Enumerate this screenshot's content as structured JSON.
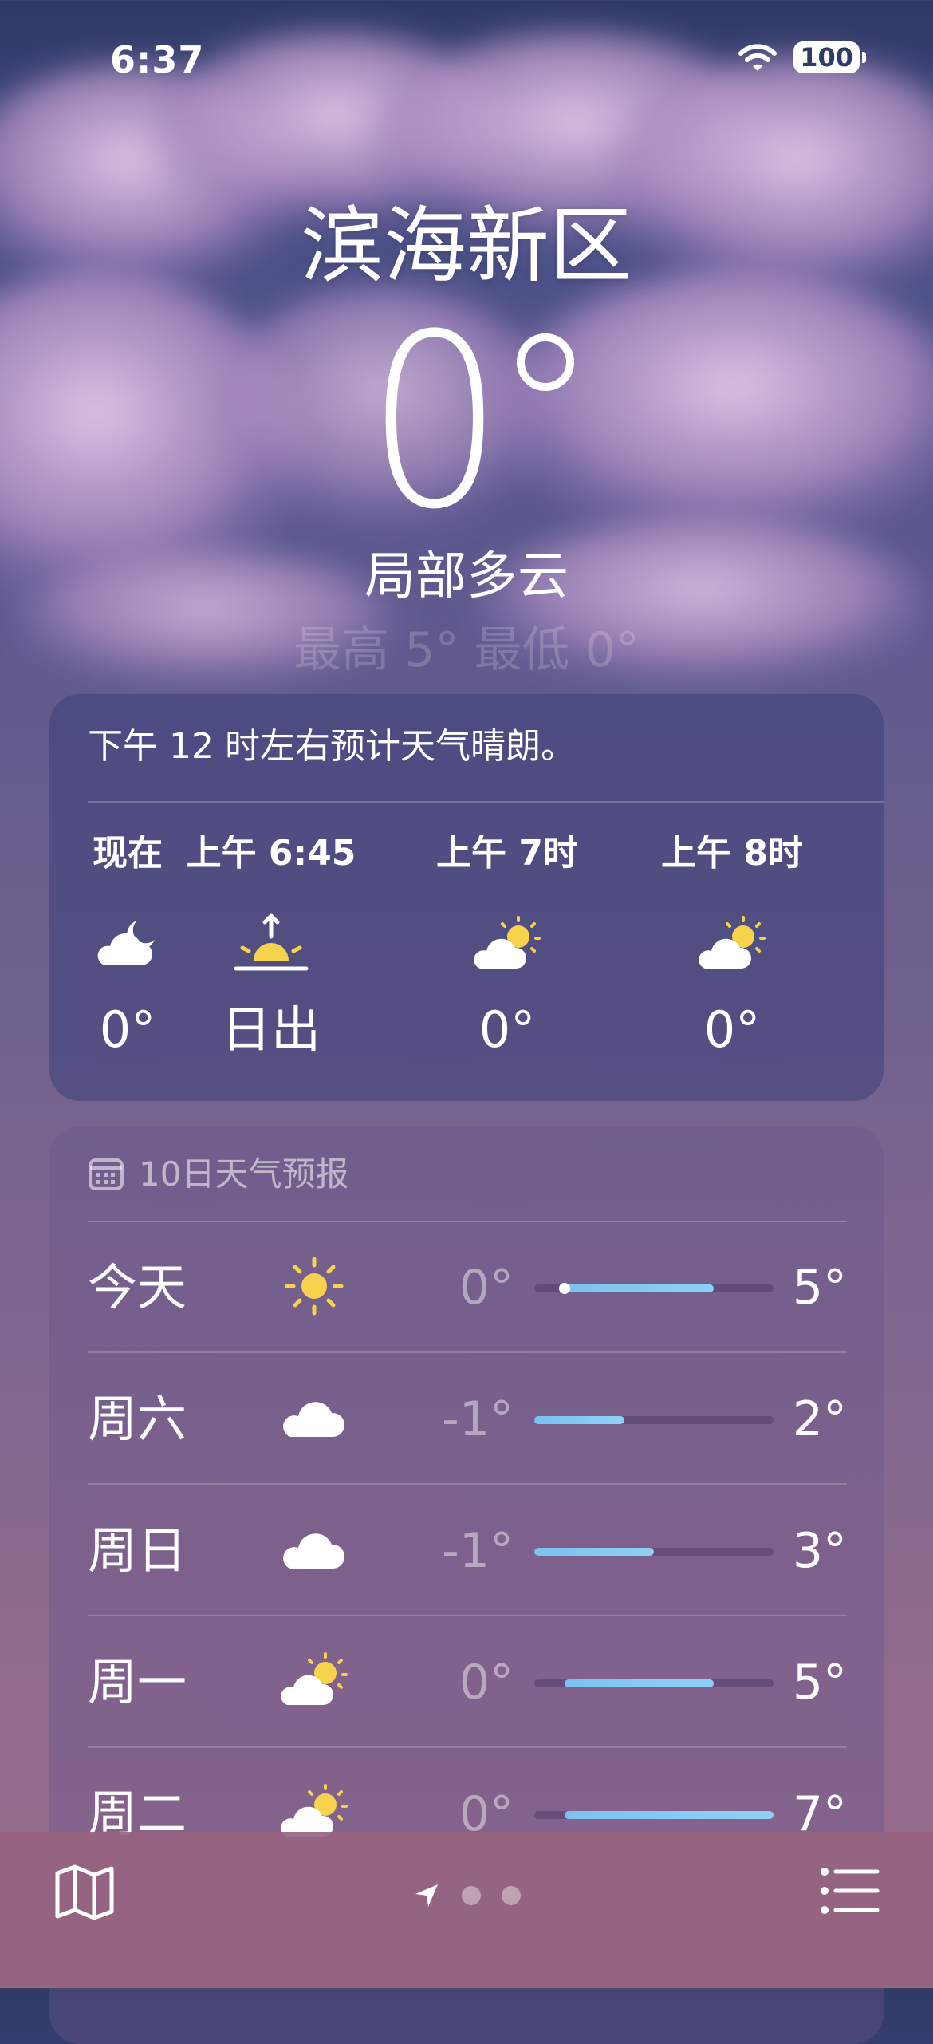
{
  "status_bar": {
    "time": "6:37",
    "battery": "100"
  },
  "location": {
    "city": "滨海新区",
    "temperature": "0",
    "condition": "局部多云",
    "hi_lo": "最高 5° 最低 0°"
  },
  "hourly": {
    "summary": "下午 12 时左右预计天气晴朗。",
    "items": [
      {
        "label": "现在",
        "icon": "cloud-moon-icon",
        "value": "0°"
      },
      {
        "label": "上午 6:45",
        "icon": "sunrise-icon",
        "value": "日出"
      },
      {
        "label": "上午 7时",
        "icon": "cloud-sun-icon",
        "value": "0°"
      },
      {
        "label": "上午 8时",
        "icon": "cloud-sun-icon",
        "value": "0°"
      }
    ]
  },
  "forecast": {
    "title": "10日天气预报",
    "scale": {
      "min": -1,
      "max": 7
    },
    "days": [
      {
        "name": "今天",
        "icon": "sun-icon",
        "low": "0°",
        "high": "5°",
        "low_value": 0,
        "high_value": 5,
        "current_value": 0
      },
      {
        "name": "周六",
        "icon": "cloud-icon",
        "low": "-1°",
        "high": "2°",
        "low_value": -1,
        "high_value": 2
      },
      {
        "name": "周日",
        "icon": "cloud-icon",
        "low": "-1°",
        "high": "3°",
        "low_value": -1,
        "high_value": 3
      },
      {
        "name": "周一",
        "icon": "cloud-sun-icon",
        "low": "0°",
        "high": "5°",
        "low_value": 0,
        "high_value": 5
      },
      {
        "name": "周二",
        "icon": "cloud-sun-icon",
        "low": "0°",
        "high": "7°",
        "low_value": 0,
        "high_value": 7
      }
    ]
  },
  "bottom_bar": {
    "left_icon": "map-icon",
    "right_icon": "list-icon",
    "pager": [
      "location-arrow-icon",
      "page-dot",
      "page-dot"
    ]
  }
}
